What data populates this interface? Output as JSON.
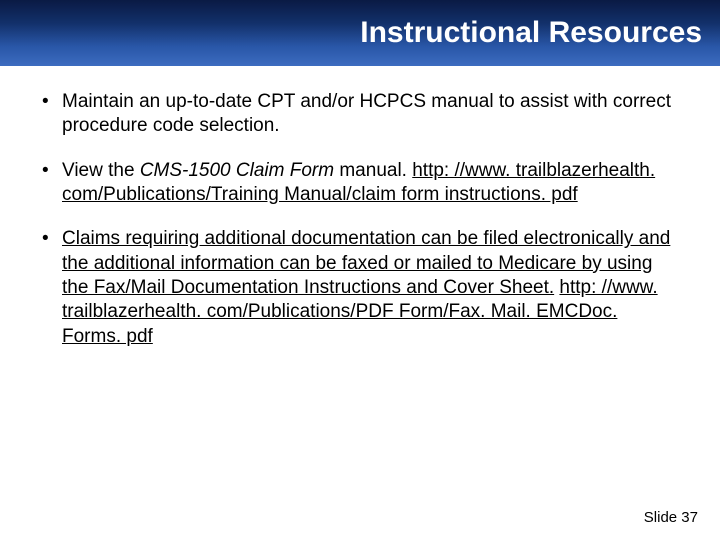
{
  "title": "Instructional Resources",
  "bullets": {
    "b1": "Maintain an up-to-date CPT and/or HCPCS manual to assist with correct procedure code selection.",
    "b2_pre": "View the ",
    "b2_italic": "CMS-1500 Claim Form",
    "b2_post": " manual. ",
    "b2_link": "http: //www. trailblazerhealth. com/Publications/Training Manual/claim form instructions. pdf",
    "b3_text": "Claims requiring additional documentation can be filed electronically and the additional information can be faxed or mailed to Medicare by using the Fax/Mail Documentation Instructions and Cover Sheet.",
    "b3_link": "http: //www. trailblazerhealth. com/Publications/PDF Form/Fax. Mail. EMCDoc. Forms. pdf"
  },
  "footer": "Slide 37"
}
